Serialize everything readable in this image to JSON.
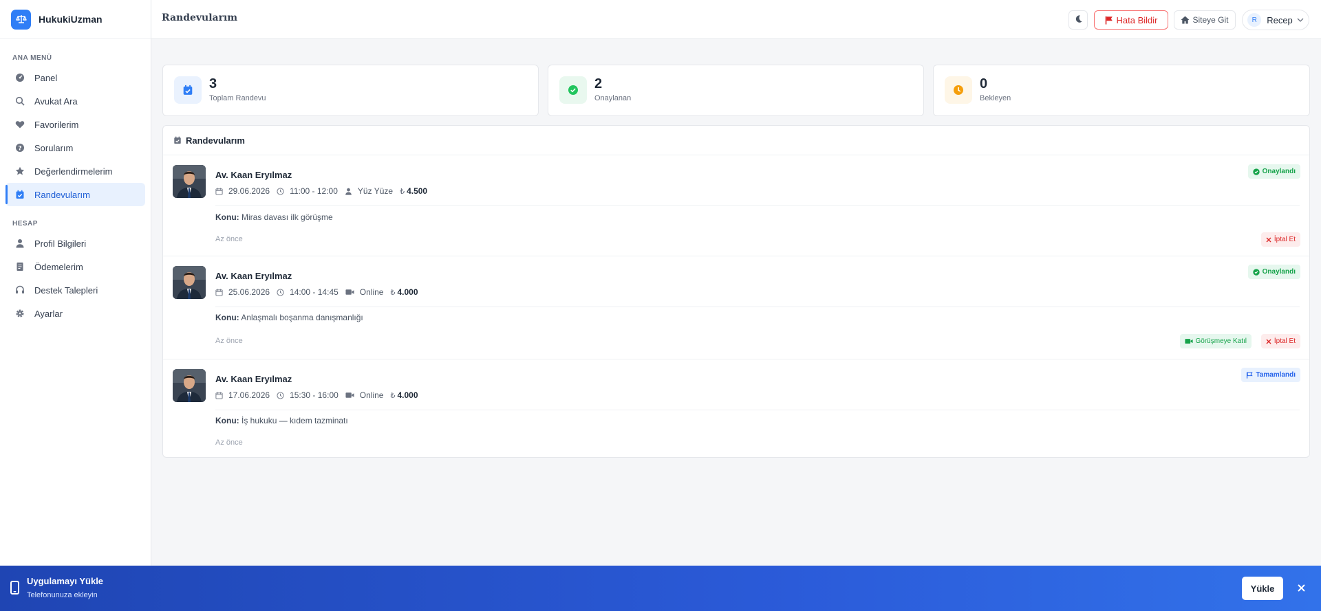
{
  "brand": {
    "name": "HukukiUzman"
  },
  "sidebar": {
    "section_main": "ANA MENÜ",
    "section_account": "HESAP",
    "main_items": [
      {
        "label": "Panel",
        "icon": "dashboard-icon"
      },
      {
        "label": "Avukat Ara",
        "icon": "search-icon"
      },
      {
        "label": "Favorilerim",
        "icon": "heart-icon"
      },
      {
        "label": "Sorularım",
        "icon": "question-icon"
      },
      {
        "label": "Değerlendirmelerim",
        "icon": "star-icon"
      },
      {
        "label": "Randevularım",
        "icon": "calendar-check-icon",
        "active": true
      }
    ],
    "account_items": [
      {
        "label": "Profil Bilgileri",
        "icon": "user-icon"
      },
      {
        "label": "Ödemelerim",
        "icon": "receipt-icon"
      },
      {
        "label": "Destek Talepleri",
        "icon": "headset-icon"
      },
      {
        "label": "Ayarlar",
        "icon": "gear-icon"
      }
    ]
  },
  "header": {
    "title": "Randevularım",
    "report_bug": "Hata Bildir",
    "go_site": "Siteye Git",
    "user_initial": "R",
    "user_name": "Recep"
  },
  "stats": [
    {
      "value": "3",
      "label": "Toplam Randevu",
      "color": "#2f7ef6"
    },
    {
      "value": "2",
      "label": "Onaylanan",
      "color": "#22c55e"
    },
    {
      "value": "0",
      "label": "Bekleyen",
      "color": "#f59e0b"
    }
  ],
  "list": {
    "title": "Randevularım",
    "topic_label": "Konu:",
    "appointments": [
      {
        "lawyer": "Av. Kaan Eryılmaz",
        "date": "29.06.2026",
        "time": "11:00 - 12:00",
        "mode": "Yüz Yüze",
        "price": "4.500",
        "topic": "Miras davası ilk görüşme",
        "ago": "Az önce",
        "status": "Onaylandı",
        "cancel": "İptal Et"
      },
      {
        "lawyer": "Av. Kaan Eryılmaz",
        "date": "25.06.2026",
        "time": "14:00 - 14:45",
        "mode": "Online",
        "price": "4.000",
        "topic": "Anlaşmalı boşanma danışmanlığı",
        "ago": "Az önce",
        "status": "Onaylandı",
        "join": "Görüşmeye Katıl",
        "cancel": "İptal Et"
      },
      {
        "lawyer": "Av. Kaan Eryılmaz",
        "date": "17.06.2026",
        "time": "15:30 - 16:00",
        "mode": "Online",
        "price": "4.000",
        "topic": "İş hukuku — kıdem tazminatı",
        "ago": "Az önce",
        "status": "Tamamlandı"
      }
    ]
  },
  "install_banner": {
    "title": "Uygulamayı Yükle",
    "subtitle": "Telefonunuza ekleyin",
    "button": "Yükle"
  }
}
